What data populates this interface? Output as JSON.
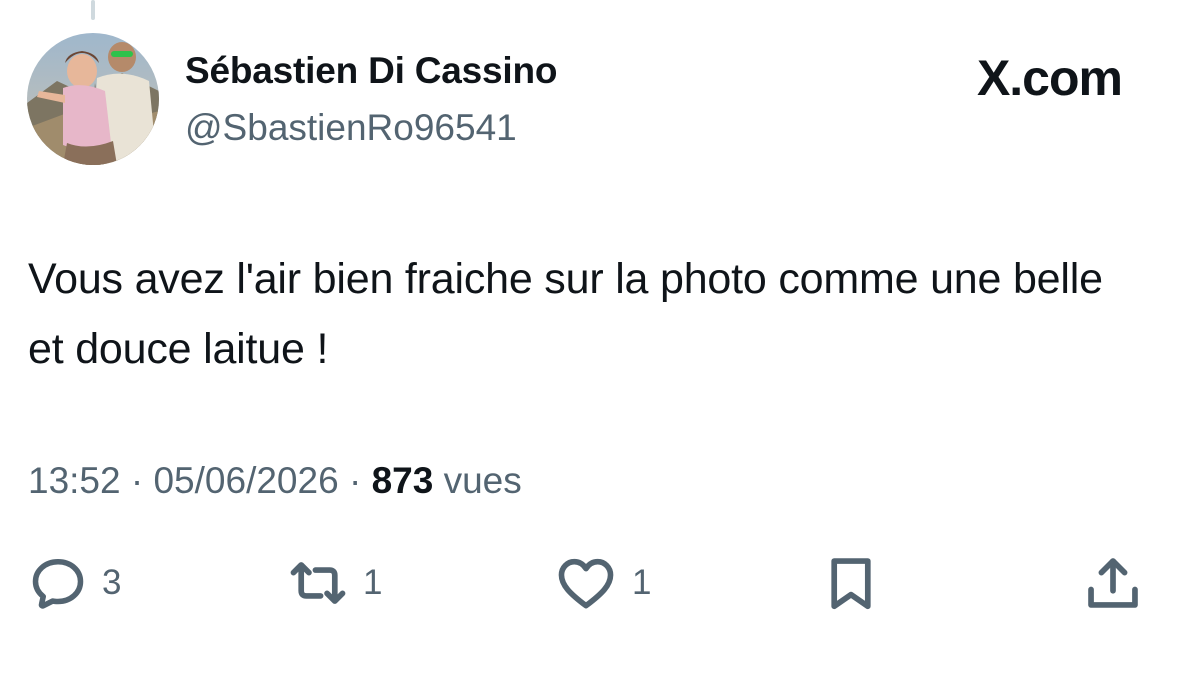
{
  "tweet": {
    "author": {
      "display_name": "Sébastien Di Cassino",
      "handle": "@SbastienRo96541"
    },
    "brand": "X.com",
    "text": "Vous avez l'air bien fraiche sur la photo comme une belle et douce laitue !",
    "meta": {
      "time": "13:52",
      "separator": "·",
      "date": "05/06/2026",
      "views_count": "873",
      "views_label": "vues"
    },
    "actions": {
      "replies": "3",
      "reposts": "1",
      "likes": "1"
    }
  },
  "icons": {
    "reply": "reply-icon",
    "repost": "repost-icon",
    "like": "heart-icon",
    "bookmark": "bookmark-icon",
    "share": "share-icon"
  },
  "colors": {
    "text_primary": "#0f1419",
    "text_secondary": "#536471",
    "icon": "#536471"
  }
}
